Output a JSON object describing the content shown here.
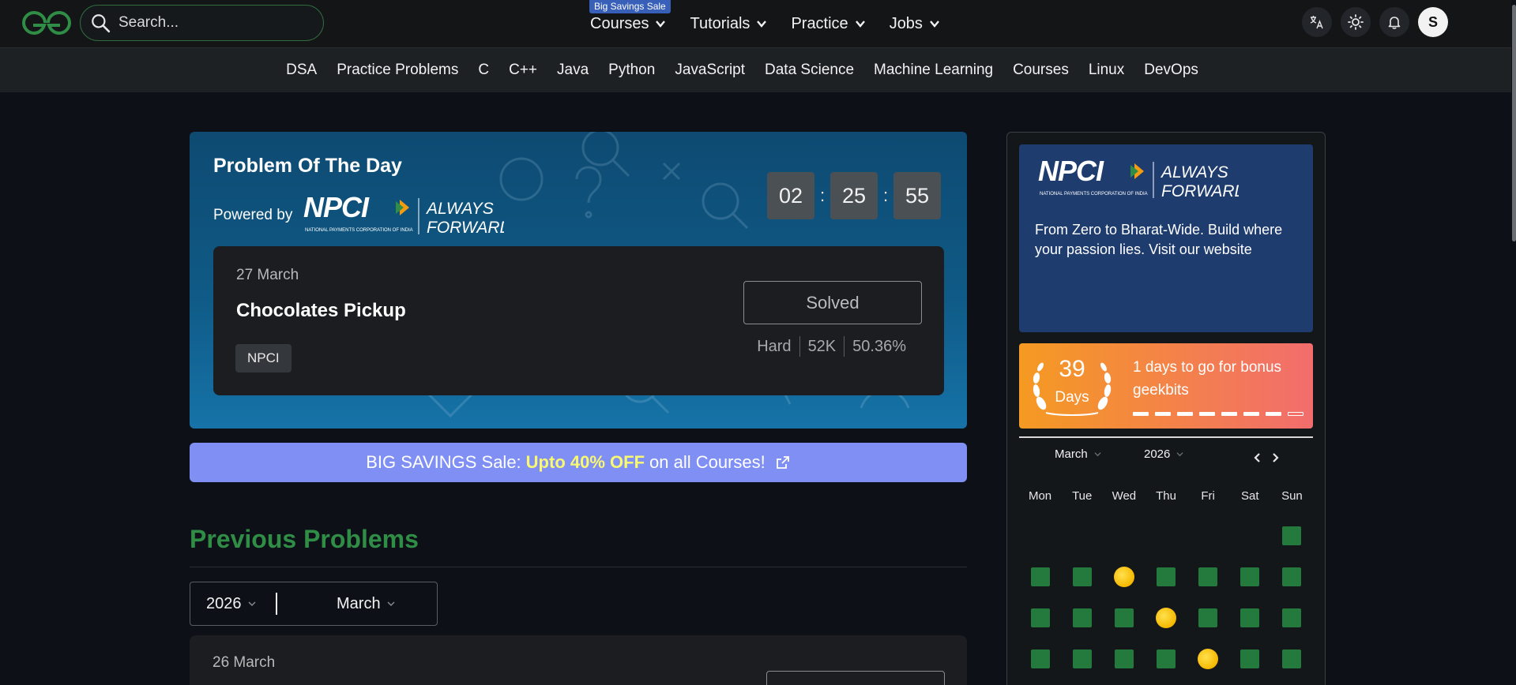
{
  "header": {
    "search_placeholder": "Search...",
    "sale_badge": "Big Savings Sale",
    "nav": [
      "Courses",
      "Tutorials",
      "Practice",
      "Jobs"
    ],
    "avatar_letter": "S"
  },
  "subnav": [
    "DSA",
    "Practice Problems",
    "C",
    "C++",
    "Java",
    "Python",
    "JavaScript",
    "Data Science",
    "Machine Learning",
    "Courses",
    "Linux",
    "DevOps"
  ],
  "potd": {
    "title": "Problem Of The Day",
    "powered_by": "Powered by",
    "logo_text": "NPCI",
    "logo_tagline_1": "ALWAYS",
    "logo_tagline_2": "FORWARD",
    "logo_small": "NATIONAL PAYMENTS CORPORATION OF INDIA",
    "timer": {
      "hours": "02",
      "minutes": "25",
      "seconds": "55",
      "sep": ":"
    },
    "date": "27 March",
    "problem": "Chocolates Pickup",
    "tag": "NPCI",
    "status": "Solved",
    "difficulty": "Hard",
    "submissions": "52K",
    "accuracy": "50.36%"
  },
  "sale_banner": {
    "prefix": "BIG SAVINGS Sale: ",
    "highlight": "Upto 40% OFF",
    "suffix": " on all Courses!"
  },
  "previous": {
    "title": "Previous Problems",
    "year": "2026",
    "month": "March",
    "first_date": "26 March"
  },
  "sidebar": {
    "ad_text": "From Zero to Bharat-Wide. Build where your passion lies. Visit our website",
    "streak_count": "39",
    "streak_unit": "Days",
    "streak_text": "1 days to go for bonus geekbits",
    "streak_progress": {
      "filled": 7,
      "total": 8
    },
    "calendar": {
      "month": "March",
      "year": "2026",
      "weekdays": [
        "Mon",
        "Tue",
        "Wed",
        "Thu",
        "Fri",
        "Sat",
        "Sun"
      ],
      "rows": [
        [
          "",
          "",
          "",
          "",
          "",
          "",
          "solved"
        ],
        [
          "solved",
          "solved",
          "coin",
          "solved",
          "solved",
          "solved",
          "solved"
        ],
        [
          "solved",
          "solved",
          "solved",
          "coin",
          "solved",
          "solved",
          "solved"
        ],
        [
          "solved",
          "solved",
          "solved",
          "solved",
          "coin",
          "solved",
          "solved"
        ]
      ]
    }
  },
  "colors": {
    "brand_green": "#2f8d46",
    "solved_green": "#237a3c",
    "coin_gold": "#f5b800",
    "sale_purple": "#7f8ff4"
  }
}
